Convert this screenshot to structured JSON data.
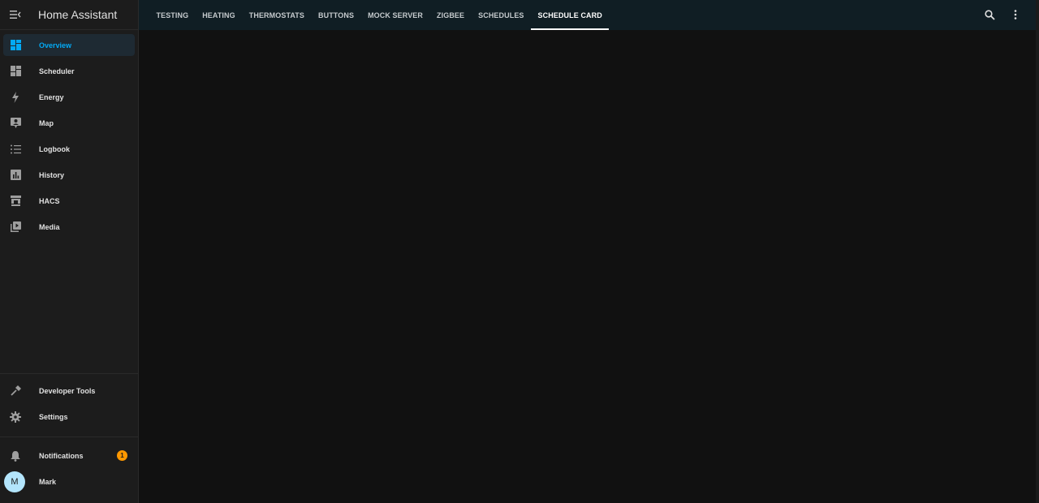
{
  "app": {
    "title": "Home Assistant"
  },
  "sidebar": {
    "items": [
      {
        "label": "Overview",
        "icon": "view-dashboard-icon",
        "active": true
      },
      {
        "label": "Scheduler",
        "icon": "view-dashboard-icon"
      },
      {
        "label": "Energy",
        "icon": "lightning-bolt-icon"
      },
      {
        "label": "Map",
        "icon": "account-box-icon"
      },
      {
        "label": "Logbook",
        "icon": "format-list-bulleted-icon"
      },
      {
        "label": "History",
        "icon": "chart-box-icon"
      },
      {
        "label": "HACS",
        "icon": "hacs-store-icon"
      },
      {
        "label": "Media",
        "icon": "play-box-multiple-icon"
      }
    ],
    "bottom_items": [
      {
        "label": "Developer Tools",
        "icon": "hammer-icon"
      },
      {
        "label": "Settings",
        "icon": "cog-icon"
      }
    ],
    "notifications": {
      "label": "Notifications",
      "count": "1",
      "icon": "bell-icon"
    },
    "user": {
      "name": "Mark",
      "initial": "M"
    }
  },
  "topbar": {
    "tabs": [
      "TESTING",
      "HEATING",
      "THERMOSTATS",
      "BUTTONS",
      "MOCK SERVER",
      "ZIGBEE",
      "SCHEDULES",
      "SCHEDULE CARD"
    ],
    "active_tab": "SCHEDULE CARD",
    "icons": [
      "search-icon",
      "more-vertical-icon"
    ]
  },
  "colors": {
    "accent": "#03a9f4",
    "badge": "#ff9800",
    "sidebar_bg": "#1c1c1c",
    "topbar_bg": "#101e24",
    "main_bg": "#111111"
  }
}
